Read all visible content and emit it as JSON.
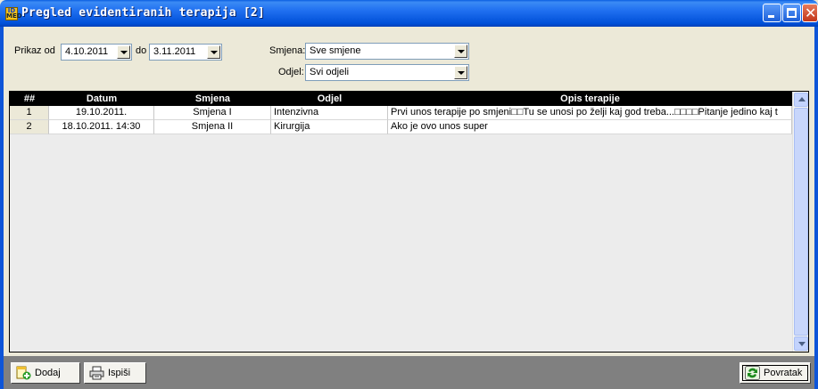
{
  "window": {
    "title": "Pregled evidentiranih terapija  [2]",
    "app_icon_text_top": "ID",
    "app_icon_text_bottom": "MED"
  },
  "filters": {
    "from_label": "Prikaz od",
    "from_value": "4.10.2011",
    "to_label": "do",
    "to_value": "3.11.2011",
    "shift_label": "Smjena:",
    "shift_value": "Sve smjene",
    "dept_label": "Odjel:",
    "dept_value": "Svi odjeli"
  },
  "grid": {
    "columns": [
      "##",
      "Datum",
      "Smjena",
      "Odjel",
      "Opis terapije"
    ],
    "rows": [
      {
        "num": "1",
        "datum": "19.10.2011.",
        "smjena": "Smjena I",
        "odjel": "Intenzivna",
        "opis": "Prvi unos terapije po smjeni□□Tu se unosi po želji kaj god treba...□□□□Pitanje jedino kaj t"
      },
      {
        "num": "2",
        "datum": "18.10.2011.  14:30",
        "smjena": "Smjena II",
        "odjel": "Kirurgija",
        "opis": "Ako je ovo unos super"
      }
    ]
  },
  "toolbar": {
    "add_label": "Dodaj",
    "print_label": "Ispiši",
    "back_label": "Povratak"
  },
  "icons": {
    "add": "add-document-icon",
    "print": "printer-icon",
    "back": "refresh-icon"
  }
}
